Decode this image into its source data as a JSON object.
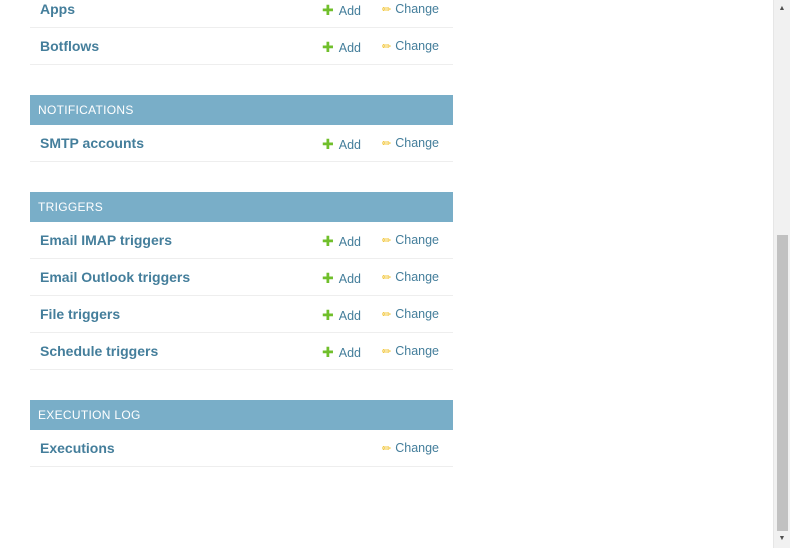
{
  "icons": {
    "add": "plus-icon",
    "change": "pencil-icon",
    "add_color": "#70bf2b",
    "change_color": "#efb80b"
  },
  "colors": {
    "module_header_bg": "#79aec8",
    "link": "#447e9b"
  },
  "modules": [
    {
      "title": "",
      "models": [
        {
          "name": "Apps",
          "add_label": "Add",
          "change_label": "Change"
        },
        {
          "name": "Botflows",
          "add_label": "Add",
          "change_label": "Change"
        }
      ]
    },
    {
      "title": "NOTIFICATIONS",
      "models": [
        {
          "name": "SMTP accounts",
          "add_label": "Add",
          "change_label": "Change"
        }
      ]
    },
    {
      "title": "TRIGGERS",
      "models": [
        {
          "name": "Email IMAP triggers",
          "add_label": "Add",
          "change_label": "Change"
        },
        {
          "name": "Email Outlook triggers",
          "add_label": "Add",
          "change_label": "Change"
        },
        {
          "name": "File triggers",
          "add_label": "Add",
          "change_label": "Change"
        },
        {
          "name": "Schedule triggers",
          "add_label": "Add",
          "change_label": "Change"
        }
      ]
    },
    {
      "title": "EXECUTION LOG",
      "models": [
        {
          "name": "Executions",
          "add_label": "",
          "change_label": "Change"
        }
      ]
    }
  ]
}
